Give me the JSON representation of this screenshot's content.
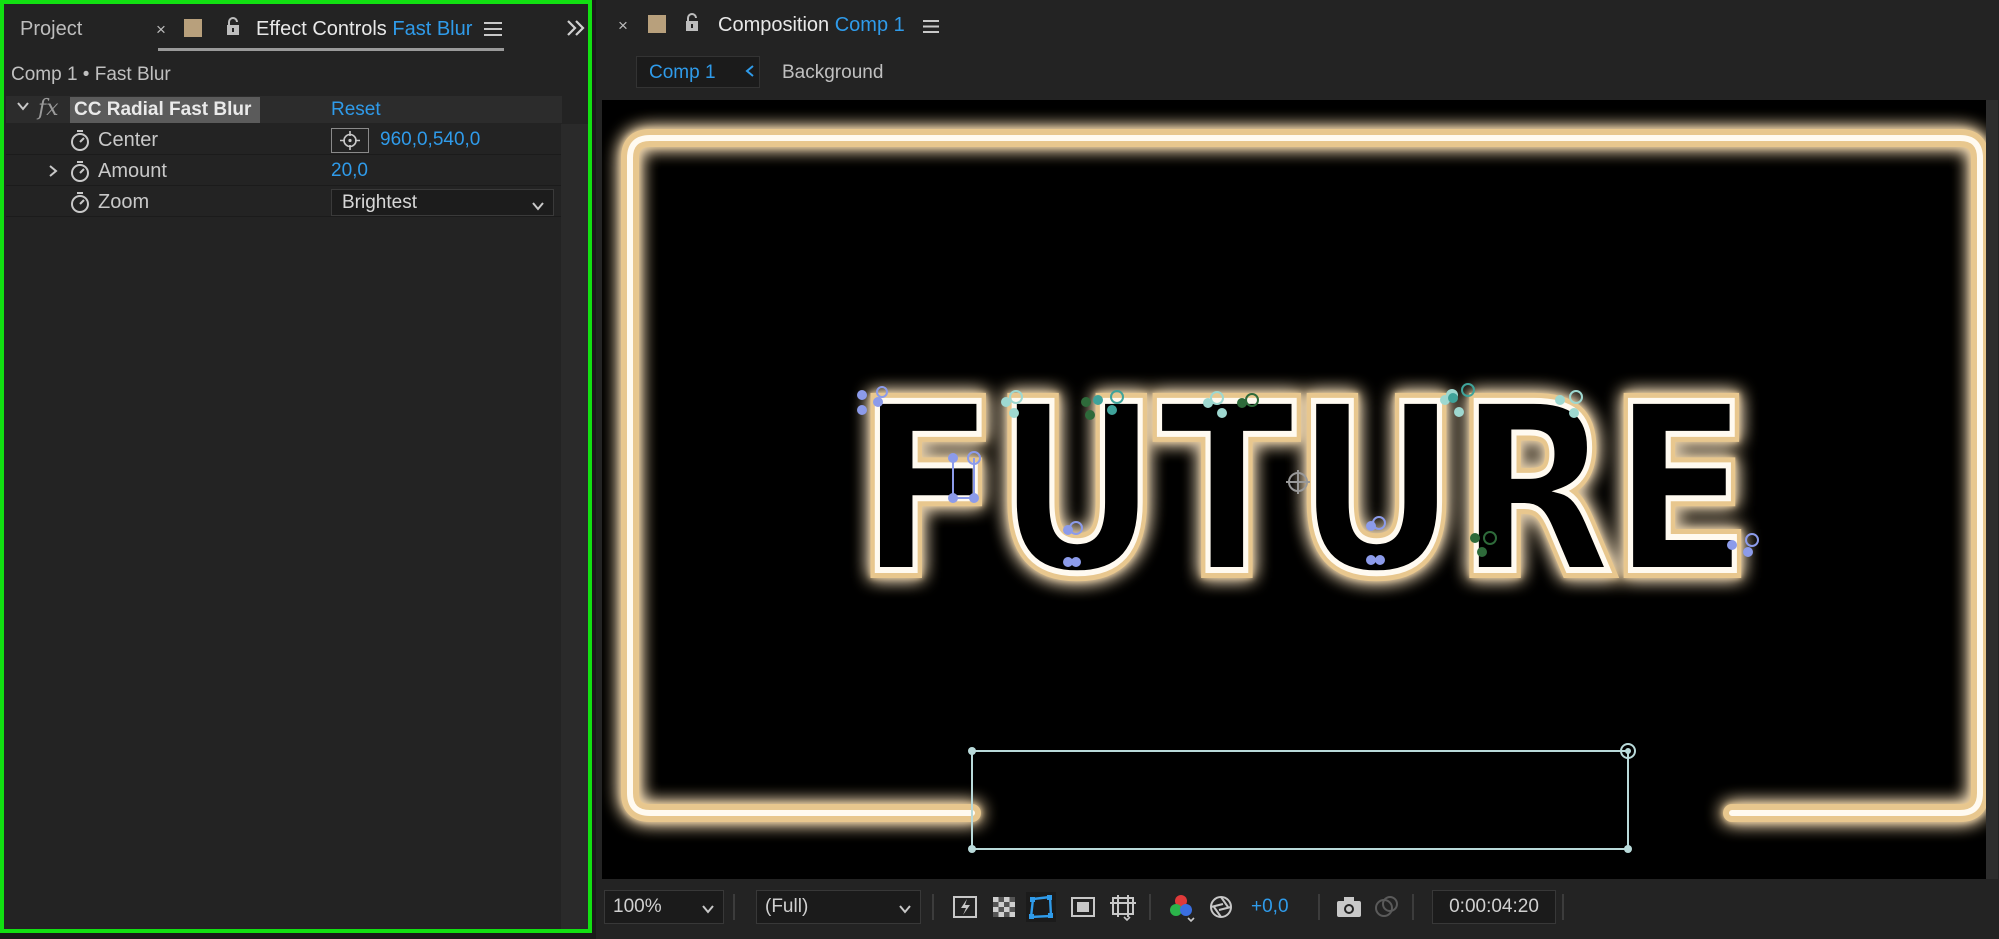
{
  "effect_controls": {
    "tab_project": "Project",
    "tab_effect_controls_prefix": "Effect Controls",
    "tab_effect_controls_layer": "Fast Blur",
    "breadcrumb": "Comp 1 • Fast Blur",
    "effect": {
      "name": "CC Radial Fast Blur",
      "reset_label": "Reset",
      "properties": [
        {
          "label": "Center",
          "value": "960,0,540,0"
        },
        {
          "label": "Amount",
          "value": "20,0"
        },
        {
          "label": "Zoom",
          "value": "Brightest"
        }
      ]
    }
  },
  "composition": {
    "tab_prefix": "Composition",
    "tab_name": "Comp 1",
    "view_tabs": [
      "Comp 1",
      "Background"
    ],
    "canvas_text": "FUTURE"
  },
  "viewer_bar": {
    "zoom": "100%",
    "resolution": "(Full)",
    "exposure": "+0,0",
    "timecode": "0:00:04:20"
  },
  "colors": {
    "accent_blue": "#2f9bea",
    "selection_border": "#12e012",
    "label_swatch": "#b8a07c"
  },
  "icons": {
    "close": "close-icon",
    "lock": "lock-icon",
    "menu": "hamburger-menu-icon",
    "expand_panels": "double-chevron-right-icon",
    "stopwatch": "stopwatch-icon",
    "fx": "fx-icon",
    "point_control": "crosshair-icon",
    "camera": "snapshot-camera-icon"
  }
}
